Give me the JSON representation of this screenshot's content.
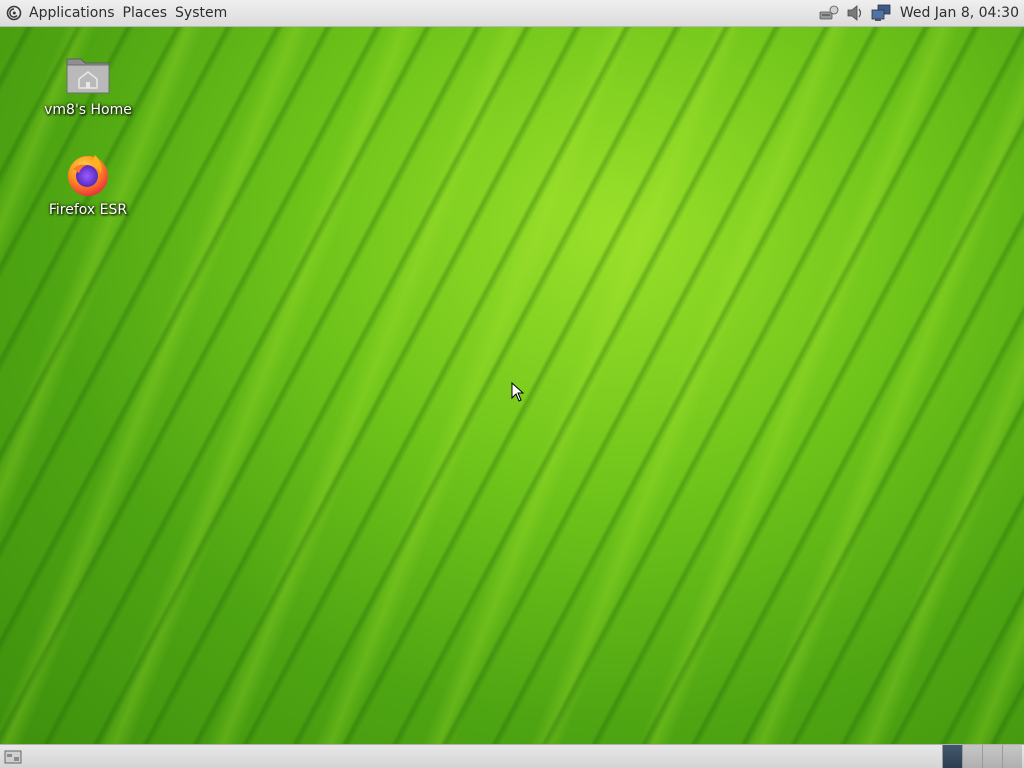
{
  "top_panel": {
    "menus": [
      {
        "label": "Applications"
      },
      {
        "label": "Places"
      },
      {
        "label": "System"
      }
    ],
    "tray_icons": [
      "network-wired-icon",
      "volume-icon",
      "display-network-icon"
    ],
    "clock": "Wed Jan  8, 04:30"
  },
  "desktop": {
    "icons": [
      {
        "label": "vm8's Home",
        "icon": "home-folder-icon"
      },
      {
        "label": "Firefox ESR",
        "icon": "firefox-icon"
      }
    ]
  },
  "bottom_panel": {
    "workspaces": [
      {
        "active": true
      },
      {
        "active": false
      },
      {
        "active": false
      },
      {
        "active": false
      }
    ]
  },
  "colors": {
    "wallpaper_green": "#5fbb17",
    "panel_bg": "#e2e2e2",
    "active_workspace": "#34485c"
  }
}
